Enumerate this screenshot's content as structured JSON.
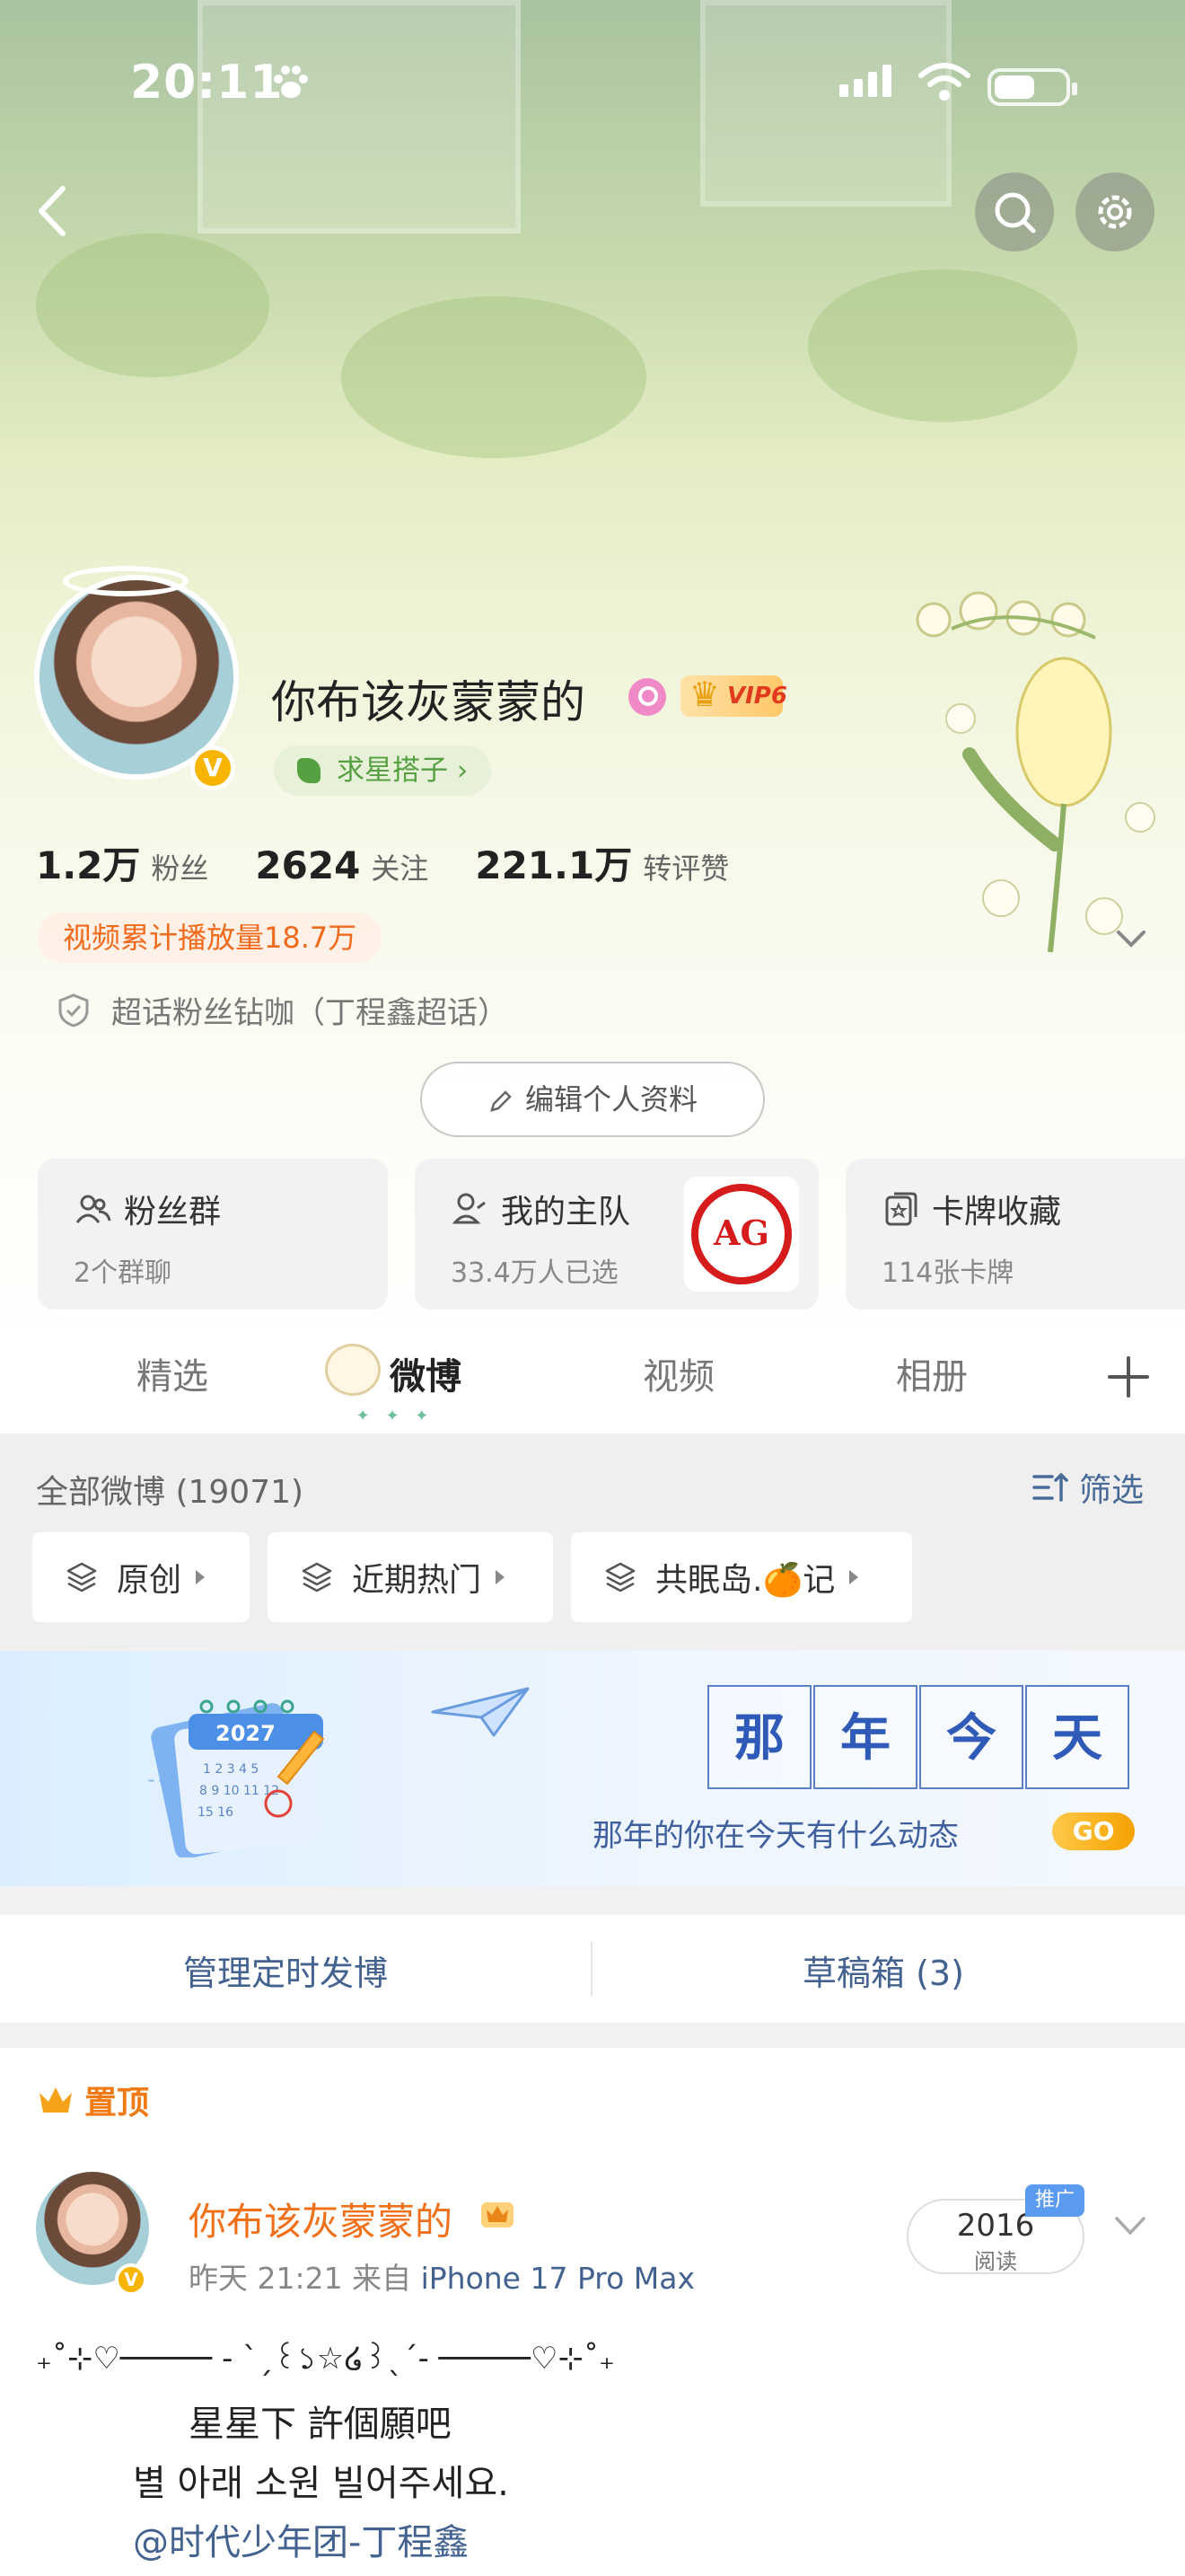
{
  "status_bar": {
    "time": "20:11"
  },
  "profile": {
    "nickname": "你布该灰蒙蒙的",
    "vip_level": "VIP6",
    "star_tag": "求星搭子 ›",
    "stats": [
      {
        "value": "1.2万",
        "label": "粉丝"
      },
      {
        "value": "2624",
        "label": "关注"
      },
      {
        "value": "221.1万",
        "label": "转评赞"
      }
    ],
    "video_plays": "视频累计播放量18.7万",
    "super_topic": "超话粉丝钻咖（丁程鑫超话）",
    "edit_button": "编辑个人资料"
  },
  "cards": [
    {
      "title": "粉丝群",
      "sub": "2个群聊"
    },
    {
      "title": "我的主队",
      "sub": "33.4万人已选",
      "logo_text": "AG"
    },
    {
      "title": "卡牌收藏",
      "sub": "114张卡牌"
    }
  ],
  "tabs": [
    "精选",
    "微博",
    "视频",
    "相册"
  ],
  "tab_active": "微博",
  "filter": {
    "count_label": "全部微博 (19071)",
    "screen_label": "筛选",
    "chips": [
      "原创",
      "近期热门",
      "共眠岛.🍊记"
    ]
  },
  "banner": {
    "title_chars": [
      "那",
      "年",
      "今",
      "天"
    ],
    "subtitle": "那年的你在今天有什么动态",
    "go": "GO",
    "calendar_year": "2027"
  },
  "manage": {
    "left": "管理定时发博",
    "right": "草稿箱 (3)"
  },
  "post": {
    "pinned_label": "置顶",
    "author": "你布该灰蒙蒙的",
    "time": "昨天 21:21",
    "from_label": "来自",
    "device": "iPhone 17 Pro Max",
    "reads": "2016",
    "reads_label": "阅读",
    "promo": "推广",
    "lines": [
      "₊˚⊹♡───── - ˋˏ꒰১☆໒꒱ˎˊ- ─────♡⊹˚₊",
      "星星下 許個願吧",
      "별 아래 소원 빌어주세요."
    ],
    "mention": "@时代少年团-丁程鑫"
  }
}
